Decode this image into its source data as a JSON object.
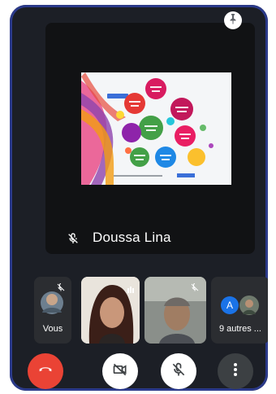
{
  "presenter": {
    "name": "Doussa Lina"
  },
  "participants": {
    "self_label": "Vous",
    "others_label": "9 autres ...",
    "others_avatar_letter": "A"
  },
  "icons": {
    "pin": "pin-icon",
    "mic_off": "mic-off-icon",
    "camera_off": "camera-off-icon",
    "end_call": "end-call-icon",
    "more": "more-vert-icon"
  },
  "colors": {
    "background": "#1c1f26",
    "end_call": "#ea4335",
    "control": "#3c4043",
    "avatar_blue": "#1a73e8",
    "frame": "#2b3a8a"
  }
}
